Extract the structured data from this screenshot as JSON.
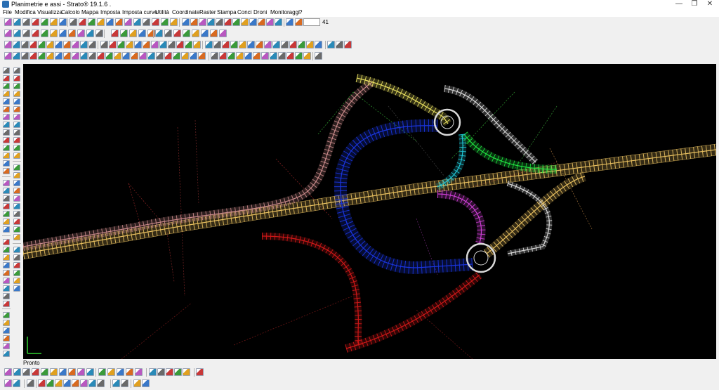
{
  "window": {
    "title": "Planimetrie e assi - Strato® 19.1.6 .",
    "minimize": "—",
    "restore": "❐",
    "close": "✕"
  },
  "menu": [
    {
      "label": "File"
    },
    {
      "label": "Modifica"
    },
    {
      "label": "Visualizza"
    },
    {
      "label": "Calcolo"
    },
    {
      "label": "Mappa"
    },
    {
      "label": "Imposta"
    },
    {
      "label": "Imposta curve"
    },
    {
      "label": "Utilità"
    },
    {
      "label": "Coordinate"
    },
    {
      "label": "Raster"
    },
    {
      "label": "Stampa"
    },
    {
      "label": "Conci"
    },
    {
      "label": "Droni"
    },
    {
      "label": "Monitoraggi"
    },
    {
      "label": "?"
    }
  ],
  "toolbar": {
    "zoom_value": "41"
  },
  "status": {
    "text": "Pronto"
  },
  "colors": {
    "canvas": "#000000",
    "road_main": "#e8c060",
    "road_pink": "#c98a8a",
    "ramp_blue": "#1a35e0",
    "ramp_red": "#d01818",
    "ramp_yellow": "#e8e060",
    "ramp_green": "#20e040",
    "ramp_cyan": "#20c8d8",
    "ramp_magenta": "#d040d8",
    "ramp_white": "#d8d8d8"
  },
  "icons": {
    "app": "app-icon",
    "axis": "axis-triad-icon"
  }
}
